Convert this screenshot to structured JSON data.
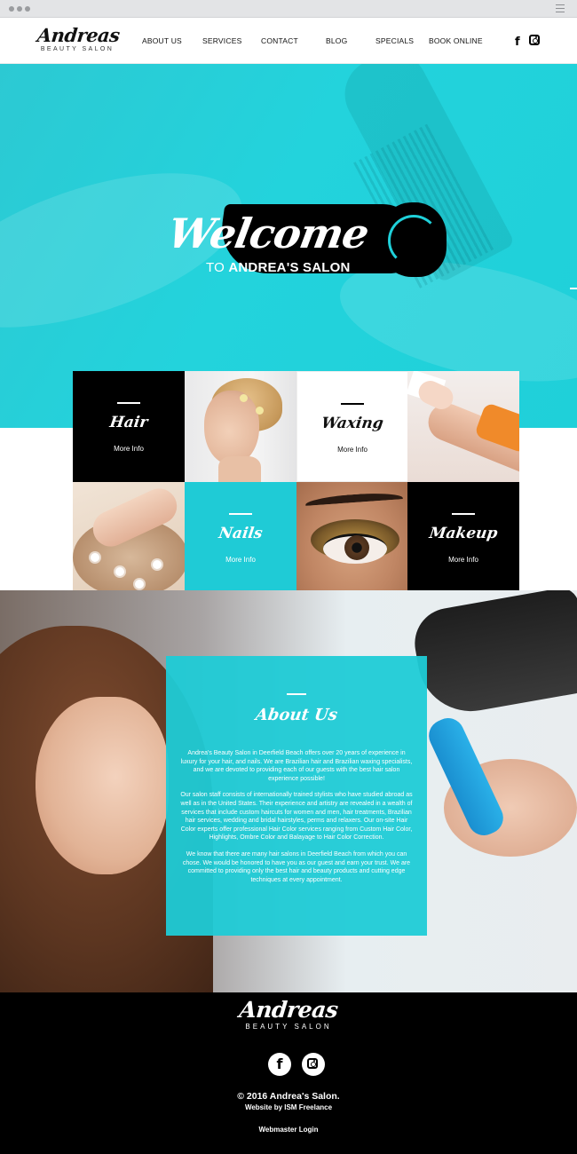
{
  "brand": {
    "name": "Andreas",
    "tagline": "BEAUTY SALON"
  },
  "nav": {
    "items": [
      {
        "label": "ABOUT US"
      },
      {
        "label": "SERVICES"
      },
      {
        "label": "CONTACT"
      },
      {
        "label": "BLOG"
      },
      {
        "label": "SPECIALS"
      },
      {
        "label": "BOOK ONLINE"
      }
    ],
    "social_icons": [
      "facebook-icon",
      "instagram-icon"
    ]
  },
  "hero": {
    "welcome": "Welcome",
    "sub_prefix": "TO",
    "sub_name": "ANDREA'S SALON",
    "accent_color": "#1fd0d9"
  },
  "services": {
    "tiles": [
      {
        "title": "Hair",
        "link": "More Info",
        "style": "black"
      },
      {
        "title": "Waxing",
        "link": "More Info",
        "style": "white"
      },
      {
        "title": "Nails",
        "link": "More Info",
        "style": "teal"
      },
      {
        "title": "Makeup",
        "link": "More Info",
        "style": "black"
      }
    ]
  },
  "about": {
    "title": "About Us",
    "paragraphs": [
      "Andrea's Beauty Salon in Deerfield Beach offers over 20 years of experience in luxury for your hair, and nails.  We are Brazilian hair and Brazilian waxing specialists, and we are devoted to providing each of our guests with the best hair salon experience possible!",
      "Our salon staff consists of internationally trained stylists who have studied abroad as well as in the United States. Their experience and artistry are revealed in a wealth of services that include custom haircuts for women and men, hair treatments, Brazilian hair services, wedding and bridal hairstyles, perms and relaxers. Our on-site Hair Color experts offer professional Hair Color services ranging from Custom Hair Color, Highlights, Ombre Color and Balayage to Hair Color Correction.",
      "We know that there are many hair salons in Deerfield Beach from which you can chose. We would be honored to have you as our guest and earn your trust. We are committed to providing only the best hair and beauty products and cutting edge techniques at every appointment."
    ]
  },
  "footer": {
    "brand_name": "Andreas",
    "brand_tagline": "BEAUTY SALON",
    "copyright": "© 2016 Andrea's Salon.",
    "credit": "Website by ISM Freelance",
    "webmaster": "Webmaster Login"
  },
  "colors": {
    "teal": "#1fcbd6",
    "black": "#000000",
    "white": "#ffffff"
  }
}
